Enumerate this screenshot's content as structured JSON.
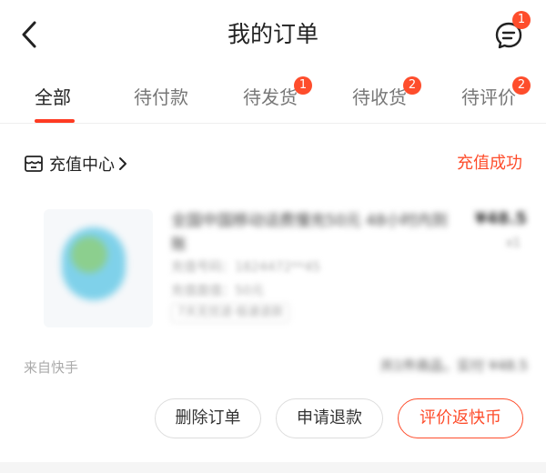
{
  "header": {
    "title": "我的订单",
    "message_badge": "1",
    "back_icon": "back-chevron-icon",
    "message_icon": "message-icon"
  },
  "tabs": [
    {
      "label": "全部",
      "active": true,
      "badge": ""
    },
    {
      "label": "待付款",
      "active": false,
      "badge": ""
    },
    {
      "label": "待发货",
      "active": false,
      "badge": "1"
    },
    {
      "label": "待收货",
      "active": false,
      "badge": "2"
    },
    {
      "label": "待评价",
      "active": false,
      "badge": "2"
    }
  ],
  "order": {
    "shop_name": "充值中心",
    "shop_icon": "store-icon",
    "status": "充值成功",
    "product": {
      "title": "全国中国移动话费慢充50元 48小时内到账",
      "price": "¥48.5",
      "quantity": "x1",
      "meta_1": "充值号码：1824472**45",
      "meta_2": "充值面值：50元",
      "tag": "7天无忧退·极速退款"
    },
    "source": "来自快手",
    "total": "共1件商品，实付 ¥48.5",
    "actions": {
      "delete": "删除订单",
      "refund": "申请退款",
      "review": "评价返快币"
    }
  },
  "colors": {
    "accent": "#fe4d2c",
    "badge": "#fe4d2c",
    "tab_underline": "#fe3b22"
  }
}
